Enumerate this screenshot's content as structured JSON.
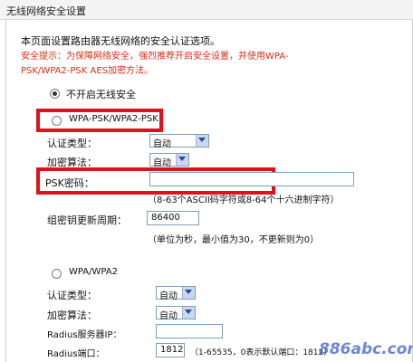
{
  "header": {
    "title": "无线网络安全设置"
  },
  "intro": {
    "line1": "本页面设置路由器无线网络的安全认证选项。",
    "tip1": "安全提示：为保障网络安全，强烈推荐开启安全设置，并使用WPA-",
    "tip2": "PSK/WPA2-PSK AES加密方法。"
  },
  "options": {
    "none_label": "不开启无线安全",
    "wpa_psk_label": "WPA-PSK/WPA2-PSK",
    "wpa_label": "WPA/WPA2"
  },
  "psk_section": {
    "auth_label": "认证类型：",
    "auth_value": "自动",
    "enc_label": "加密算法：",
    "enc_value": "自动",
    "psk_label": "PSK密码：",
    "psk_value": "",
    "psk_hint": "（8-63个ASCII码字符或8-64个十六进制字符）",
    "rekey_label": "组密钥更新周期：",
    "rekey_value": "86400",
    "rekey_hint": "（单位为秒，最小值为30，不更新则为0）"
  },
  "wpa_section": {
    "auth_label": "认证类型：",
    "auth_value": "自动",
    "enc_label": "加密算法：",
    "enc_value": "自动",
    "radius_ip_label": "Radius服务器IP：",
    "radius_ip_value": "",
    "radius_port_label": "Radius端口：",
    "radius_port_value": "1812",
    "radius_port_hint": "（1-65535，0表示默认端口：1812）"
  },
  "watermark": "886abc.com",
  "colors": {
    "highlight": "#e0101c",
    "tip": "#d63016",
    "watermark": "#3a5fc8"
  }
}
